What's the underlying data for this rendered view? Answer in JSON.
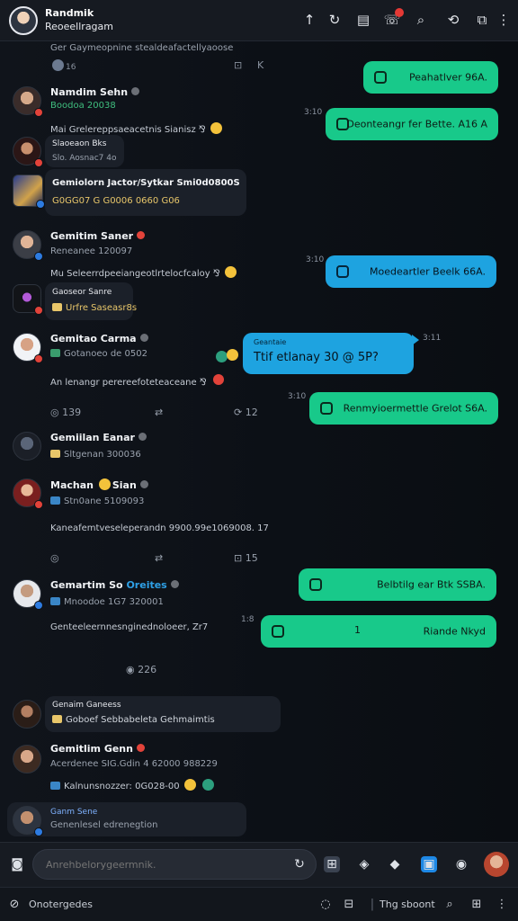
{
  "header": {
    "title": "Randmik",
    "subtitle": "Reoeellragam",
    "icons": [
      "pin-icon",
      "refresh-icon",
      "briefcase-icon",
      "call-icon",
      "search-icon",
      "sync-icon",
      "clipboard-icon",
      "more-icon"
    ]
  },
  "feed": {
    "top_line": "Ger Gaymeopnine stealdeafactellyaoose",
    "top_counts": {
      "left": "16",
      "right_a": "⊡",
      "right_b": "K"
    },
    "sent_1": {
      "text": "Peahatlver 96A.",
      "color": "#18c98a"
    },
    "time_1": "3:10",
    "sent_2": {
      "text": "Deonteangr fer Bette. A16 A",
      "color": "#18c98a"
    },
    "post_1": {
      "name": "Namdim Sehn",
      "sub": "Boodoa 20038",
      "text": "Mai Grelereppsaeacetnis Sianisz"
    },
    "post_2": {
      "name": "Slaoeaon Bks",
      "sub": "Slo. Aosnac7 4o"
    },
    "post_3": {
      "name": "Gemiolorn Jactor/Sytkar Smi0d0800S",
      "sub": "G0GG07 G G0006 0660 G06"
    },
    "post_4": {
      "name": "Gemitim Saner",
      "sub": "Reneanee 120097",
      "text": "Mu Seleerrdpeeiangeotlrtelocfcaloy"
    },
    "time_2": "3:10",
    "sent_3": {
      "text": "Moedeartler Beelk 66A.",
      "color": "#1ea3e0"
    },
    "post_5": {
      "name": "Gaoseor Sanre",
      "sub": "Urfre Saseasr8s"
    },
    "post_6": {
      "name": "Gemitao Carma",
      "sub": "Gotanoeo de 0502",
      "text": "An lenangr perereefoteteaceane"
    },
    "sent_4": {
      "label": "Geantaie",
      "text": "Ttif etlanay 30 @ 5P?",
      "color": "#1ea3e0"
    },
    "time_3": "3:11",
    "actions_1": {
      "count": "139",
      "right": "12"
    },
    "time_4": "3:10",
    "sent_5": {
      "text": "Renmyioermettle Grelot S6A.",
      "color": "#18c98a"
    },
    "post_7": {
      "name": "Gemiilan Eanar",
      "sub": "Sltgenan 300036"
    },
    "post_8": {
      "name": "Machan",
      "tag": "Sian",
      "sub": "Stn0ane 5109093"
    },
    "post_8_text": "Kaneafemtveseleperandn 9900.99e1069008. 17",
    "actions_2": {
      "right": "15"
    },
    "post_9": {
      "name": "Gemartim So",
      "tag": "Oreites",
      "sub": "Mnoodoe 1G7 320001",
      "text": "Genteeleernnesnginednoloeer, Zr7"
    },
    "time_5": "1:8",
    "sent_6": {
      "text": "Belbtilg ear Btk SSBA.",
      "color": "#18c98a"
    },
    "sent_7": {
      "num": "1",
      "text": "Riande Nkyd",
      "color": "#18c98a"
    },
    "divider_count": "226",
    "post_10": {
      "name": "Genaim Ganeess",
      "sub": "Goboef Sebbabeleta Gehmaimtis"
    },
    "post_11": {
      "name": "Gemitlim Genn",
      "sub": "Acerdenee SIG.Gdin 4 62000 988229",
      "text": "Kalnunsnozzer: 0G028-00"
    },
    "post_12": {
      "name": "Ganm Sene",
      "sub": "Genenlesel edrenegtion"
    }
  },
  "composer": {
    "placeholder": "Anrehbelorygeermnik."
  },
  "status": {
    "left": "Onotergedes",
    "right": "Thg sboont"
  },
  "colors": {
    "green": "#18c98a",
    "blue": "#1ea3e0",
    "bg": "#0d1016"
  }
}
